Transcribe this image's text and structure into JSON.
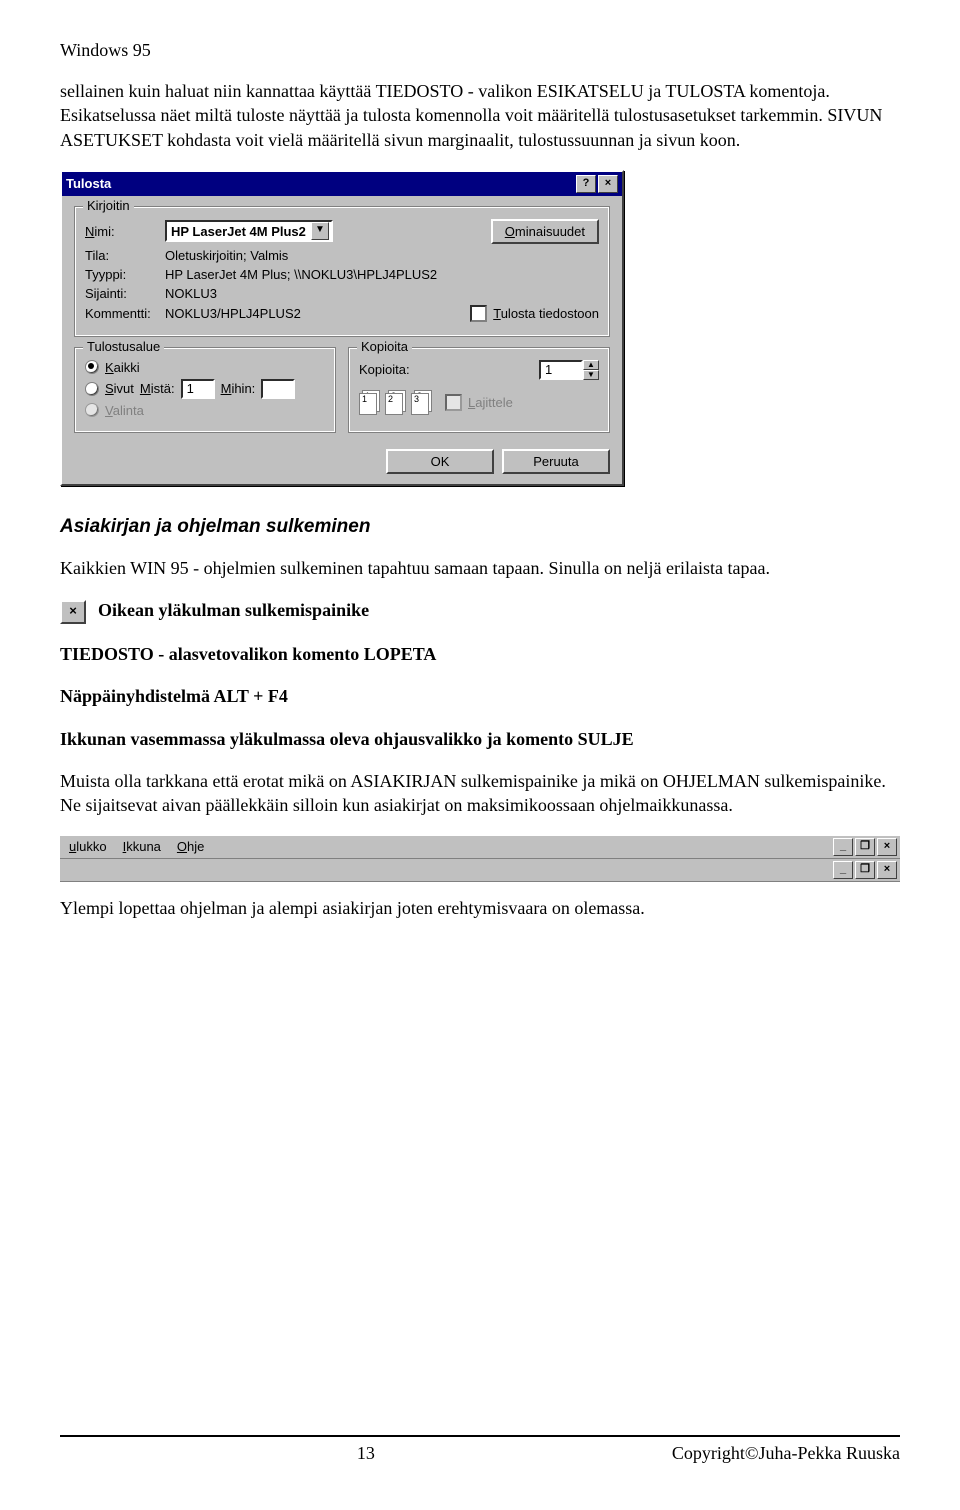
{
  "header": "Windows 95",
  "para1": "sellainen kuin haluat niin kannattaa käyttää TIEDOSTO - valikon ESIKATSELU ja TULOSTA komentoja. Esikatselussa näet miltä tuloste näyttää ja tulosta komennolla voit määritellä tulostusasetukset tarkemmin. SIVUN ASETUKSET kohdasta voit vielä määritellä sivun marginaalit, tulostussuunnan ja sivun koon.",
  "dialog": {
    "title": "Tulosta",
    "help": "?",
    "close": "×",
    "printerGroup": "Kirjoitin",
    "nameLabelU": "N",
    "nameLabelRest": "imi:",
    "printerName": "HP LaserJet 4M Plus2",
    "propsU": "O",
    "propsRest": "minaisuudet",
    "tilaL": "Tila:",
    "tilaV": "Oletuskirjoitin; Valmis",
    "tyyppiL": "Tyyppi:",
    "tyyppiV": "HP LaserJet 4M Plus; \\\\NOKLU3\\HPLJ4PLUS2",
    "sijL": "Sijainti:",
    "sijV": "NOKLU3",
    "komL": "Kommentti:",
    "komV": "NOKLU3/HPLJ4PLUS2",
    "toFileU": "T",
    "toFileRest": "ulosta tiedostoon",
    "rangeGroup": "Tulostusalue",
    "rAllU": "K",
    "rAllRest": "aikki",
    "rPagesU": "S",
    "rPagesRest": "ivut",
    "fromU": "M",
    "fromRest": "istä:",
    "fromV": "1",
    "toU": "M",
    "toRest": "ihin:",
    "rSelU": "V",
    "rSelRest": "alinta",
    "copiesGroup": "Kopioita",
    "copiesL": "Kopioita:",
    "copiesV": "1",
    "c1": "1",
    "c2": "2",
    "c3": "3",
    "collateU": "L",
    "collateRest": "ajittele",
    "ok": "OK",
    "cancel": "Peruuta"
  },
  "sectionTitle": "Asiakirjan ja ohjelman sulkeminen",
  "para2": "Kaikkien WIN 95 - ohjelmien sulkeminen tapahtuu samaan tapaan. Sinulla on neljä erilaista tapaa.",
  "closeX": "×",
  "line1": "Oikean yläkulman sulkemispainike",
  "line2a": "TIEDOSTO - alasvetovalikon  komento LOPETA",
  "line3": "Näppäinyhdistelmä ALT + F4",
  "line4": "Ikkunan vasemmassa yläkulmassa oleva ohjausvalikko ja komento SULJE",
  "para3": "Muista olla tarkkana että erotat mikä on ASIAKIRJAN sulkemispainike ja mikä on OHJELMAN sulkemispainike. Ne sijaitsevat aivan päällekkäin silloin kun asiakirjat on maksimikoossaan ohjelmaikkunassa.",
  "menus": {
    "m1U": "u",
    "m1": "lukko",
    "m2U": "I",
    "m2": "kkuna",
    "m3U": "O",
    "m3": "hje",
    "min": "_",
    "max": "❐",
    "cls": "×"
  },
  "para4": "Ylempi lopettaa ohjelman ja alempi asiakirjan joten erehtymisvaara on olemassa.",
  "pageNum": "13",
  "copyright": "Copyright©Juha-Pekka Ruuska"
}
